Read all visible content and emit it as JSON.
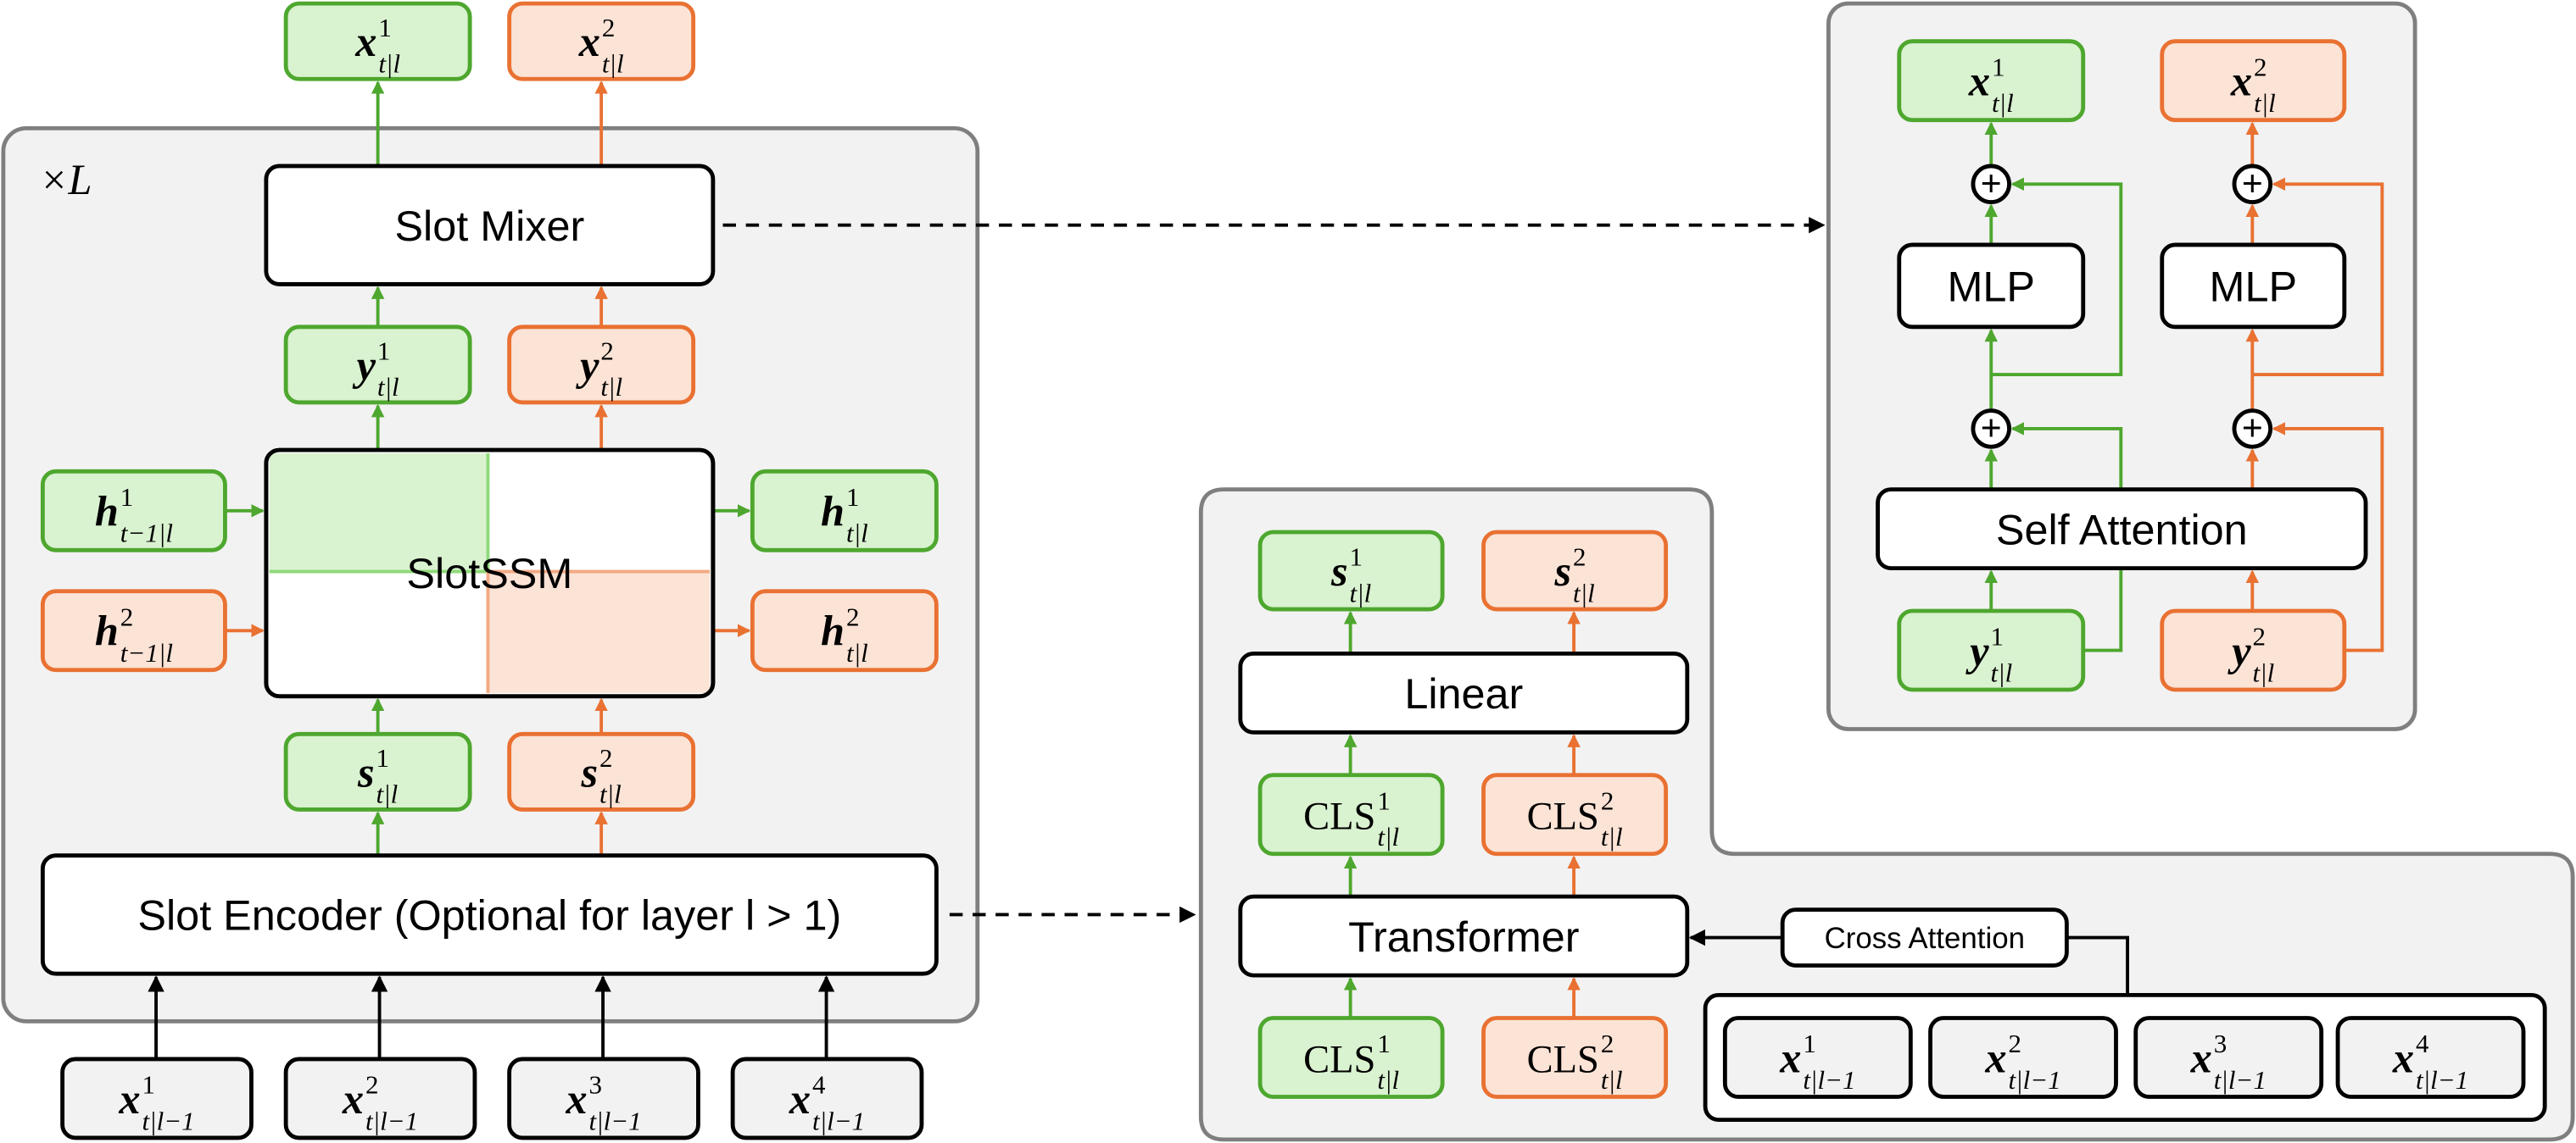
{
  "colors": {
    "green_stroke": "#4ea72e",
    "green_fill": "#d9f2d0",
    "orange_stroke": "#e97132",
    "orange_fill": "#fbe3d6",
    "panel_fill": "#f2f2f2",
    "panel_stroke": "#7f7f7f",
    "black": "#000000",
    "white": "#ffffff"
  },
  "left_panel": {
    "repeat_label": "×L",
    "slot_mixer": "Slot Mixer",
    "slotssm": "SlotSSM",
    "slot_encoder": "Slot Encoder (Optional for layer l > 1)",
    "outputs": [
      {
        "base": "x",
        "sup": "1",
        "sub": "t|l"
      },
      {
        "base": "x",
        "sup": "2",
        "sub": "t|l"
      }
    ],
    "mixer_inputs": [
      {
        "base": "y",
        "sup": "1",
        "sub": "t|l"
      },
      {
        "base": "y",
        "sup": "2",
        "sub": "t|l"
      }
    ],
    "prev_states": [
      {
        "base": "h",
        "sup": "1",
        "sub": "t−1|l"
      },
      {
        "base": "h",
        "sup": "2",
        "sub": "t−1|l"
      }
    ],
    "new_states": [
      {
        "base": "h",
        "sup": "1",
        "sub": "t|l"
      },
      {
        "base": "h",
        "sup": "2",
        "sub": "t|l"
      }
    ],
    "slots": [
      {
        "base": "s",
        "sup": "1",
        "sub": "t|l"
      },
      {
        "base": "s",
        "sup": "2",
        "sub": "t|l"
      }
    ],
    "inputs": [
      {
        "base": "x",
        "sup": "1",
        "sub": "t|l−1"
      },
      {
        "base": "x",
        "sup": "2",
        "sub": "t|l−1"
      },
      {
        "base": "x",
        "sup": "3",
        "sub": "t|l−1"
      },
      {
        "base": "x",
        "sup": "4",
        "sub": "t|l−1"
      }
    ]
  },
  "encoder_panel": {
    "linear": "Linear",
    "transformer": "Transformer",
    "cross_attention": "Cross Attention",
    "slots": [
      {
        "base": "s",
        "sup": "1",
        "sub": "t|l"
      },
      {
        "base": "s",
        "sup": "2",
        "sub": "t|l"
      }
    ],
    "cls_out": [
      {
        "base": "CLS",
        "sup": "1",
        "sub": "t|l"
      },
      {
        "base": "CLS",
        "sup": "2",
        "sub": "t|l"
      }
    ],
    "cls_in": [
      {
        "base": "CLS",
        "sup": "1",
        "sub": "t|l"
      },
      {
        "base": "CLS",
        "sup": "2",
        "sub": "t|l"
      }
    ],
    "inputs": [
      {
        "base": "x",
        "sup": "1",
        "sub": "t|l−1"
      },
      {
        "base": "x",
        "sup": "2",
        "sub": "t|l−1"
      },
      {
        "base": "x",
        "sup": "3",
        "sub": "t|l−1"
      },
      {
        "base": "x",
        "sup": "4",
        "sub": "t|l−1"
      }
    ]
  },
  "mixer_panel": {
    "mlp": [
      "MLP",
      "MLP"
    ],
    "self_attention": "Self Attention",
    "outputs": [
      {
        "base": "x",
        "sup": "1",
        "sub": "t|l"
      },
      {
        "base": "x",
        "sup": "2",
        "sub": "t|l"
      }
    ],
    "inputs": [
      {
        "base": "y",
        "sup": "1",
        "sub": "t|l"
      },
      {
        "base": "y",
        "sup": "2",
        "sub": "t|l"
      }
    ],
    "plus_symbol": "+"
  }
}
